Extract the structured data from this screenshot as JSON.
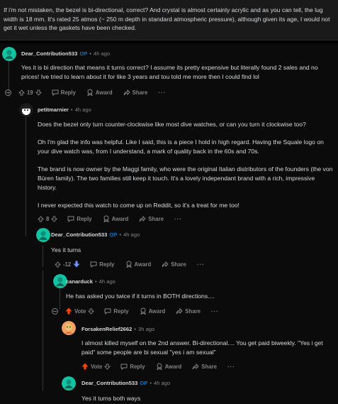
{
  "parent_comment": {
    "text": "If i'm not mistaken, the bezel is bi-directional, correct? And crystal is almost certainly acrylic and as you can tell, the lug width is 18 mm. It's rated 25 atmos (~ 250 m depth in standard atmospheric pressure), although given its age, I would not get it wet unless the gaskets have been checked."
  },
  "labels": {
    "reply": "Reply",
    "award": "Award",
    "share": "Share",
    "more": "···",
    "op": "OP",
    "dot": "•"
  },
  "comments": [
    {
      "author": "Dear_Contribution533",
      "op": true,
      "time": "4h ago",
      "paragraphs": [
        "Yes it is bi direction that means it turns correct? I assume its pretty expensive but literally found 2 sales and no prices! Ive tried to learn about it for like 3 years and tou told me more then I could find lol"
      ],
      "score": "19",
      "vote_state": "neutral",
      "avatar_color": "#13c4a3"
    },
    {
      "author": "petitmarnier",
      "op": false,
      "time": "4h ago",
      "paragraphs": [
        "Does the bezel only turn counter-clockwise like most dive watches, or can you turn it clockwise too?",
        "Oh I'm glad the info was helpful. Like I said, this is a piece I hold in high regard. Having the Squale logo on your dive watch was, from I understand, a mark of quality back in the 60s and 70s.",
        "The brand is now owner by the Maggi family, who were the original Italian distributors of the founders (the von Büren family). The two families still keep it touch. It's a lovely independant brand with a rich, impressive history.",
        "I never expected this watch to come up on Reddit, so it's a treat for me too!"
      ],
      "score": "8",
      "vote_state": "neutral",
      "avatar_color": "#1a1a1b"
    },
    {
      "author": "Dear_Contribution533",
      "op": true,
      "time": "4h ago",
      "paragraphs": [
        "Yes it turns"
      ],
      "score": "-12",
      "vote_state": "downvoted",
      "avatar_color": "#13c4a3"
    },
    {
      "author": "canarduck",
      "op": false,
      "time": "4h ago",
      "paragraphs": [
        "He has asked you twice if it turns in BOTH directions...."
      ],
      "score": "Vote",
      "vote_state": "upvoted",
      "avatar_color": "#13c4a3"
    },
    {
      "author": "ForsakenRelief2662",
      "op": false,
      "time": "3h ago",
      "paragraphs": [
        "I almost killed myself on the 2nd answer. Bi-directional.... You get paid biweekly. \"Yes i get paid\" some people are bi sexual \"yes i am sexual\""
      ],
      "score": "Vote",
      "vote_state": "upvoted",
      "avatar_color": "#f4a261"
    },
    {
      "author": "Dear_Contribution533",
      "op": true,
      "time": "4h ago",
      "paragraphs": [
        "Yes it turns both ways"
      ],
      "score": "",
      "vote_state": "none",
      "avatar_color": "#13c4a3"
    }
  ],
  "colors": {
    "upvote": "#ff4500",
    "downvote": "#7193ff",
    "op": "#0079d3",
    "muted": "#818384",
    "text": "#d7dadc"
  }
}
